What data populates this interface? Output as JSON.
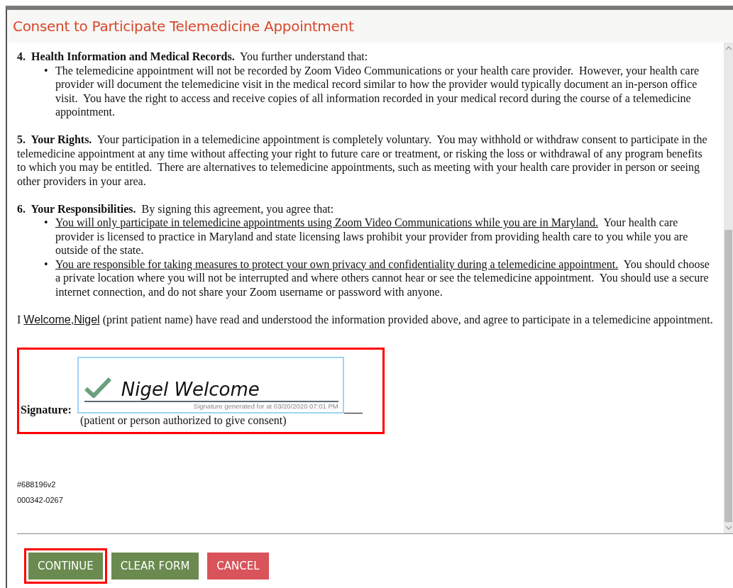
{
  "dialog": {
    "title": "Consent to Participate Telemedicine Appointment"
  },
  "sections": [
    {
      "kind": "list",
      "number": "4.",
      "heading": "Health Information and Medical Records.",
      "intro": "You further understand that:",
      "bullets": [
        {
          "marker": "•",
          "text": "The telemedicine appointment will not be recorded by Zoom Video Communications or your health care provider.  However, your health care provider will document the telemedicine visit in the medical record similar to how the provider would typically document an in-person office visit.  You have the right to access and receive copies of all information recorded in your medical record during the course of a telemedicine appointment."
        }
      ]
    },
    {
      "kind": "paragraph",
      "number": "5.",
      "heading": "Your Rights.",
      "intro": "Your participation in a telemedicine appointment is completely voluntary.  You may withhold or withdraw consent to participate in the telemedicine appointment at any time without affecting your right to future care or treatment, or risking the loss or withdrawal of any program benefits to which you may be entitled.  There are alternatives to telemedicine appointments, such as meeting with your health care provider in person or seeing other providers in your area."
    },
    {
      "kind": "list",
      "number": "6.",
      "heading": "Your Responsibilities.",
      "intro": "By signing this agreement, you agree that:",
      "bullets": [
        {
          "marker": "•",
          "underlined": "You will only participate in telemedicine appointments using Zoom Video Communications while you are in Maryland.",
          "text": "Your health care provider is licensed to practice in Maryland and state licensing laws prohibit your provider from providing health care to you while you are outside of the state."
        },
        {
          "marker": "•",
          "underlined": "You are responsible for taking measures to protect your own privacy and confidentiality during a telemedicine appointment.",
          "text": "You should choose a private location where you will not be interrupted and where others cannot hear or see the telemedicine appointment.  You should use a secure internet connection, and do not share your Zoom username or password with anyone."
        }
      ]
    }
  ],
  "acknowledgement": {
    "prefix": "I",
    "patient_name": "Welcome,Nigel",
    "suffix": "(print patient name) have read and understood the information provided above, and agree to participate in a telemedicine appointment."
  },
  "signature": {
    "highlighted": true,
    "label": "Signature:",
    "signed_name": "Nigel Welcome",
    "signed": true,
    "caption": "Signature generated for  at 03/20/2020 07:01 PM",
    "note": "(patient or person authorized to give consent)"
  },
  "document_codes": [
    "#688196v2",
    "000342-0267"
  ],
  "buttons": [
    {
      "label": "CONTINUE",
      "kind": "primary",
      "highlighted": true
    },
    {
      "label": "CLEAR FORM",
      "kind": "primary",
      "highlighted": false
    },
    {
      "label": "CANCEL",
      "kind": "danger",
      "highlighted": false
    }
  ]
}
